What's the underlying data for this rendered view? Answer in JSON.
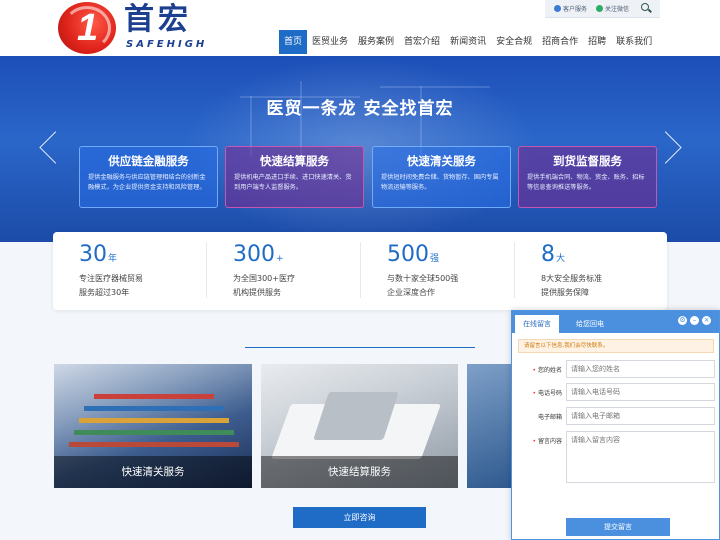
{
  "brand": {
    "name_cn": "首宏",
    "name_en": "SAFEHIGH",
    "badge_digit": "1"
  },
  "topbar": {
    "service": "客户服务",
    "wechat": "关注微信"
  },
  "nav": {
    "items": [
      "首页",
      "医贸业务",
      "服务案例",
      "首宏介绍",
      "新闻资讯",
      "安全合规",
      "招商合作",
      "招聘",
      "联系我们"
    ]
  },
  "banner": {
    "title": "医贸一条龙 安全找首宏",
    "cards": [
      {
        "title": "供应链金融服务",
        "desc": "提供金融服务与供应链管理相结合的创新金融模式，为企业提供资金支持和风险管理。"
      },
      {
        "title": "快速结算服务",
        "desc": "提供机电产品进口手续、进口快速清关、货到用户端专人监督服务。"
      },
      {
        "title": "快速清关服务",
        "desc": "提供短时间免费合储、货物暂存、国内专属物流运输等服务。"
      },
      {
        "title": "到货监督服务",
        "desc": "提供手机端合同、物流、资金、账务、招标等信息查询推送等服务。"
      }
    ]
  },
  "stats": [
    {
      "num": "30",
      "unit": "年",
      "line1": "专注医疗器械贸易",
      "line2": "服务超过30年"
    },
    {
      "num": "300",
      "unit": "+",
      "line1": "为全国300+医疗",
      "line2": "机构提供服务"
    },
    {
      "num": "500",
      "unit": "强",
      "line1": "与数十家全球500强",
      "line2": "企业深度合作"
    },
    {
      "num": "8",
      "unit": "大",
      "line1": "8大安全服务标准",
      "line2": "提供服务保障"
    }
  ],
  "services": [
    {
      "label": "快速清关服务"
    },
    {
      "label": "快速结算服务"
    }
  ],
  "consult_label": "立即咨询",
  "widget": {
    "tab_active": "在线留言",
    "tab_other": "给您回电",
    "notice": "请留言以下信息,我们会尽快联系。",
    "fields": [
      {
        "label": "您的姓名",
        "placeholder": "请输入您的姓名"
      },
      {
        "label": "电话号码",
        "placeholder": "请输入电话号码"
      },
      {
        "label": "电子邮箱",
        "placeholder": "请输入电子邮箱"
      },
      {
        "label": "留言内容",
        "placeholder": "请输入留言内容"
      }
    ],
    "submit": "提交留言"
  }
}
